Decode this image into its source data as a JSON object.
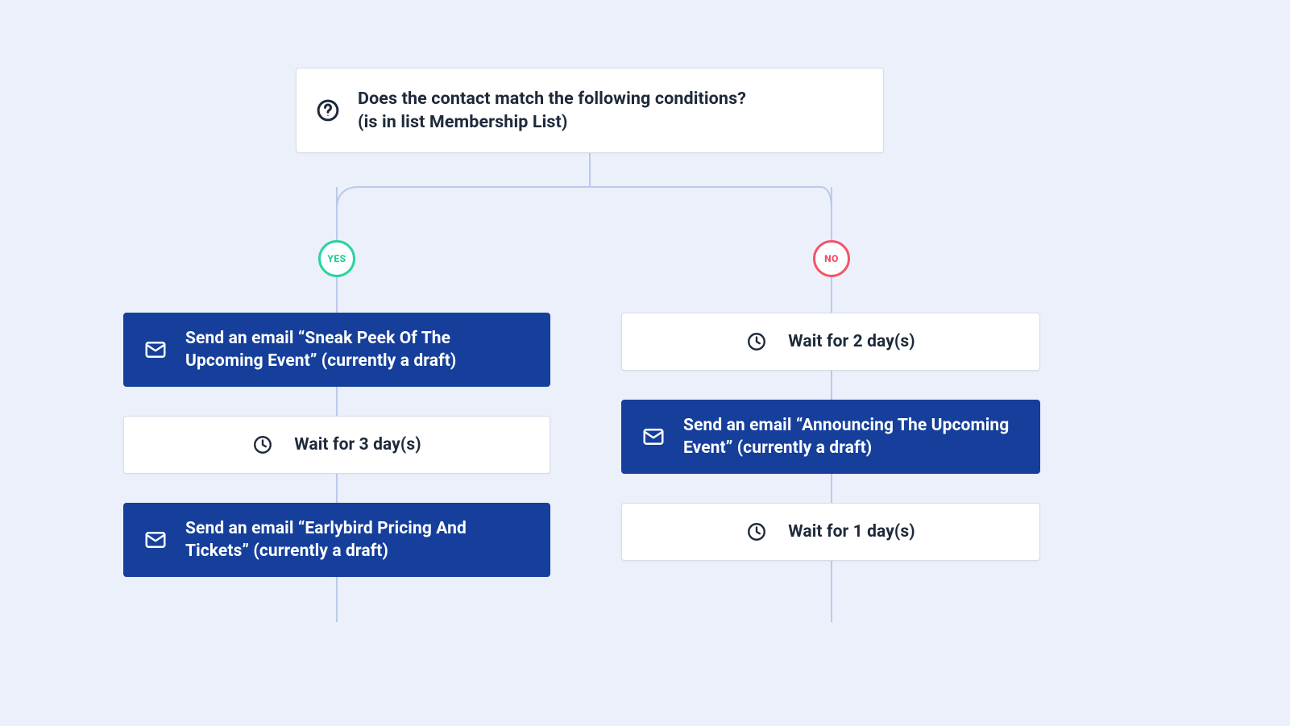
{
  "condition": {
    "line1": "Does the contact match the following conditions?",
    "line2": "(is in list Membership List)"
  },
  "branches": {
    "yes_label": "YES",
    "no_label": "NO"
  },
  "yes_branch": {
    "steps": [
      {
        "type": "email",
        "text": "Send an email “Sneak Peek Of The Upcoming Event” (currently a draft)"
      },
      {
        "type": "wait",
        "text": "Wait for 3 day(s)"
      },
      {
        "type": "email",
        "text": "Send an email “Earlybird Pricing And Tickets” (currently a draft)"
      }
    ]
  },
  "no_branch": {
    "steps": [
      {
        "type": "wait",
        "text": "Wait for 2 day(s)"
      },
      {
        "type": "email",
        "text": "Send an email “Announcing The Upcoming Event” (currently a draft)"
      },
      {
        "type": "wait",
        "text": "Wait for 1 day(s)"
      }
    ]
  },
  "colors": {
    "background": "#ebf0fb",
    "card": "#ffffff",
    "card_border": "#d7dbe7",
    "accent": "#163f9b",
    "connector": "#bcc9ea",
    "yes": "#29d3a0",
    "no": "#f2556b",
    "text": "#1e2a3a"
  }
}
